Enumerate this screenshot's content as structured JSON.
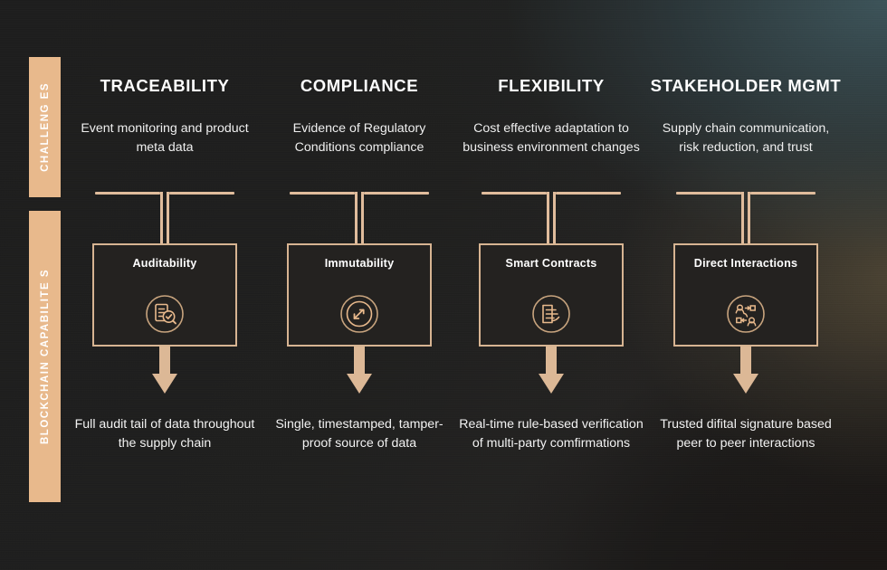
{
  "theme": {
    "accent_tan": "#e8b98c",
    "line_tan": "#e0bc9c",
    "box_border": "#d7b492",
    "text_white": "#ffffff",
    "background_dark": "#1d1d1d",
    "glow_teal": "#3e565c",
    "glow_warm": "#5c503a"
  },
  "rails": [
    {
      "label": "CHALLENG ES"
    },
    {
      "label": "BLOCKCHAIN CAPABILITE S"
    }
  ],
  "columns": [
    {
      "title": "TRACEABILITY",
      "challenge": "Event monitoring and product meta data",
      "capability": "Auditability",
      "icon": "document-magnifier-icon",
      "outcome": "Full audit tail of data throughout the supply chain"
    },
    {
      "title": "COMPLIANCE",
      "challenge": "Evidence of Regulatory Conditions compliance",
      "capability": "Immutability",
      "icon": "circular-arrows-icon",
      "outcome": "Single, timestamped, tamper-proof source of data"
    },
    {
      "title": "FLEXIBILITY",
      "challenge": "Cost effective adaptation to business environment changes",
      "capability": "Smart Contracts",
      "icon": "contract-signature-icon",
      "outcome": "Real-time rule-based verification of multi-party comfirmations"
    },
    {
      "title": "STAKEHOLDER MGMT",
      "challenge": "Supply chain communication, risk reduction, and trust",
      "capability": "Direct Interactions",
      "icon": "peer-exchange-icon",
      "outcome": "Trusted difital signature based peer to peer interactions"
    }
  ]
}
